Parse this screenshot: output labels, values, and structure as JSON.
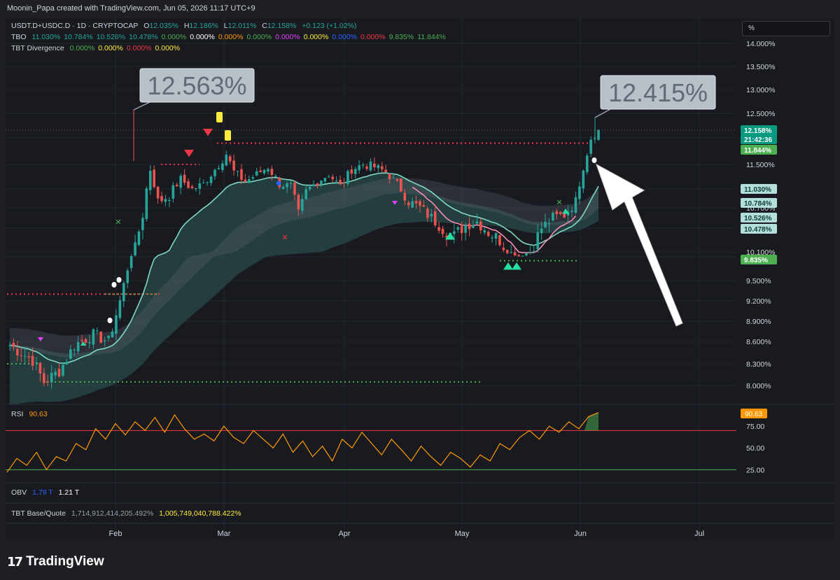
{
  "header": {
    "credit": "Moonin_Papa created with TradingView.com, Jun 05, 2026 11:17 UTC+9"
  },
  "legend": {
    "symbol": "USDT.D+USDC.D · 1D · CRYPTOCAP",
    "ohlc": [
      {
        "label": "O",
        "value": "12.035%"
      },
      {
        "label": "H",
        "value": "12.186%"
      },
      {
        "label": "L",
        "value": "12.011%"
      },
      {
        "label": "C",
        "value": "12.158%"
      }
    ],
    "change": "+0.123 (+1.02%)",
    "tbo_name": "TBO",
    "tbo_values": [
      {
        "v": "11.030%",
        "c": "#26a69a"
      },
      {
        "v": "10.784%",
        "c": "#26a69a"
      },
      {
        "v": "10.526%",
        "c": "#26a69a"
      },
      {
        "v": "10.478%",
        "c": "#26a69a"
      },
      {
        "v": "0.000%",
        "c": "#4caf50"
      },
      {
        "v": "0.000%",
        "c": "#ffffff"
      },
      {
        "v": "0.000%",
        "c": "#ff9800"
      },
      {
        "v": "0.000%",
        "c": "#4caf50"
      },
      {
        "v": "0.000%",
        "c": "#e040fb"
      },
      {
        "v": "0.000%",
        "c": "#ffeb3b"
      },
      {
        "v": "0.000%",
        "c": "#2962ff"
      },
      {
        "v": "0.000%",
        "c": "#f23645"
      },
      {
        "v": "9.835%",
        "c": "#4caf50"
      },
      {
        "v": "11.844%",
        "c": "#4caf50"
      }
    ],
    "tbt_name": "TBT Divergence",
    "tbt_values": [
      {
        "v": "0.000%",
        "c": "#4caf50"
      },
      {
        "v": "0.000%",
        "c": "#ffeb3b"
      },
      {
        "v": "0.000%",
        "c": "#f23645"
      },
      {
        "v": "0.000%",
        "c": "#ffeb3b"
      }
    ],
    "rsi_name": "RSI",
    "rsi_value": "90.63",
    "obv_name": "OBV",
    "obv_v1": "1.79 T",
    "obv_v2": "1.21 T",
    "tbtbq_name": "TBT Base/Quote",
    "tbtbq_v1": "1,714,912,414,205.492%",
    "tbtbq_v2": "1,005,749,040,788.422%"
  },
  "scale_unit": "%",
  "callouts": {
    "high_left": "12.563%",
    "high_right": "12.415%"
  },
  "price_tags": [
    {
      "text": "12.158%",
      "value": 12.158,
      "bg": "#089981",
      "fg": "#ffffff"
    },
    {
      "text": "21:42:36",
      "value": 12.02,
      "bg": "#089981",
      "fg": "#ffffff"
    },
    {
      "text": "11.844%",
      "value": 11.844,
      "bg": "#4caf50",
      "fg": "#ffffff"
    },
    {
      "text": "11.030%",
      "value": 11.03,
      "bg": "#b2dfdb",
      "fg": "#0d3b36"
    },
    {
      "text": "10.784%",
      "value": 10.784,
      "bg": "#b2dfdb",
      "fg": "#0d3b36"
    },
    {
      "text": "10.526%",
      "value": 10.526,
      "bg": "#b2dfdb",
      "fg": "#0d3b36"
    },
    {
      "text": "10.478%",
      "value": 10.478,
      "bg": "#b2dfdb",
      "fg": "#0d3b36"
    },
    {
      "text": "9.835%",
      "value": 9.835,
      "bg": "#4caf50",
      "fg": "#ffffff"
    }
  ],
  "rsi_tag": "90.63",
  "footer": {
    "brand": "TradingView",
    "logo_mark": "17"
  },
  "colors": {
    "up": "#26a69a",
    "down": "#ef5350",
    "rsi": "#ff9800",
    "ema_fast": "#7fd9c4",
    "ema_mid": "#f48fb1",
    "cloud": "#2f5b57",
    "support": "#4caf50",
    "resistance": "#f23645"
  },
  "chart_data": [
    {
      "type": "candlestick",
      "title": "USDT.D+USDC.D · 1D · CRYPTOCAP",
      "x_ticks": [
        "Feb",
        "Mar",
        "Apr",
        "May",
        "Jun",
        "Jul"
      ],
      "y_ticks": [
        "14.000%",
        "13.500%",
        "13.000%",
        "12.500%",
        "12.000%",
        "11.500%",
        "11.000%",
        "10.700%",
        "10.400%",
        "10.100%",
        "9.800%",
        "9.500%",
        "9.200%",
        "8.900%",
        "8.600%",
        "8.300%",
        "8.000%"
      ],
      "ylim": [
        7.8,
        14.2
      ],
      "annotations": [
        "12.563%",
        "12.415%"
      ],
      "levels": [
        {
          "name": "resistance",
          "value": 11.9
        },
        {
          "name": "resistance",
          "value": 11.5
        },
        {
          "name": "resistance",
          "value": 9.3
        },
        {
          "name": "support",
          "value": 9.75
        },
        {
          "name": "support",
          "value": 9.3
        },
        {
          "name": "support",
          "value": 8.3
        },
        {
          "name": "support",
          "value": 8.05
        }
      ],
      "keypoints": [
        {
          "date": "Jan 01",
          "close": 8.55
        },
        {
          "date": "Jan 07",
          "close": 8.35
        },
        {
          "date": "Jan 10",
          "close": 8.05
        },
        {
          "date": "Jan 14",
          "close": 8.2
        },
        {
          "date": "Jan 18",
          "close": 8.55
        },
        {
          "date": "Jan 23",
          "close": 8.7
        },
        {
          "date": "Jan 27",
          "close": 8.6
        },
        {
          "date": "Jan 30",
          "close": 9.2
        },
        {
          "date": "Feb 02",
          "close": 9.9
        },
        {
          "date": "Feb 05",
          "close": 10.6
        },
        {
          "date": "Feb 07",
          "close": 11.4
        },
        {
          "date": "Feb 09",
          "close": 10.8
        },
        {
          "date": "Feb 12",
          "close": 10.9
        },
        {
          "date": "Feb 15",
          "close": 11.2
        },
        {
          "date": "Feb 18",
          "close": 11.0
        },
        {
          "date": "Feb 21",
          "close": 11.1
        },
        {
          "date": "Feb 24",
          "close": 11.4
        },
        {
          "date": "Feb 27",
          "close": 11.7
        },
        {
          "date": "Mar 01",
          "close": 11.35
        },
        {
          "date": "Mar 04",
          "close": 11.15
        },
        {
          "date": "Mar 07",
          "close": 11.3
        },
        {
          "date": "Mar 10",
          "close": 11.45
        },
        {
          "date": "Mar 13",
          "close": 11.1
        },
        {
          "date": "Mar 16",
          "close": 11.05
        },
        {
          "date": "Mar 18",
          "close": 10.6
        },
        {
          "date": "Mar 20",
          "close": 10.95
        },
        {
          "date": "Mar 23",
          "close": 11.15
        },
        {
          "date": "Mar 26",
          "close": 11.3
        },
        {
          "date": "Mar 29",
          "close": 11.05
        },
        {
          "date": "Apr 01",
          "close": 11.4
        },
        {
          "date": "Apr 04",
          "close": 11.5
        },
        {
          "date": "Apr 07",
          "close": 11.45
        },
        {
          "date": "Apr 10",
          "close": 11.35
        },
        {
          "date": "Apr 13",
          "close": 11.1
        },
        {
          "date": "Apr 16",
          "close": 10.8
        },
        {
          "date": "Apr 19",
          "close": 10.7
        },
        {
          "date": "Apr 22",
          "close": 10.55
        },
        {
          "date": "Apr 25",
          "close": 10.4
        },
        {
          "date": "Apr 28",
          "close": 10.3
        },
        {
          "date": "May 01",
          "close": 10.45
        },
        {
          "date": "May 04",
          "close": 10.5
        },
        {
          "date": "May 07",
          "close": 10.35
        },
        {
          "date": "May 10",
          "close": 10.25
        },
        {
          "date": "May 13",
          "close": 10.05
        },
        {
          "date": "May 15",
          "close": 9.85
        },
        {
          "date": "May 18",
          "close": 10.1
        },
        {
          "date": "May 21",
          "close": 10.4
        },
        {
          "date": "May 24",
          "close": 10.55
        },
        {
          "date": "May 27",
          "close": 10.6
        },
        {
          "date": "May 30",
          "close": 10.8
        },
        {
          "date": "Jun 01",
          "close": 11.45
        },
        {
          "date": "Jun 03",
          "close": 12.0
        },
        {
          "date": "Jun 05",
          "close": 12.158
        }
      ]
    },
    {
      "type": "line",
      "title": "RSI",
      "y_ticks": [
        "75.00",
        "50.00",
        "25.00"
      ],
      "ylim": [
        10,
        100
      ],
      "levels": [
        {
          "name": "overbought",
          "value": 70
        },
        {
          "name": "oversold",
          "value": 25
        }
      ],
      "values": [
        22,
        38,
        30,
        45,
        25,
        40,
        35,
        55,
        48,
        72,
        60,
        78,
        65,
        80,
        70,
        85,
        68,
        88,
        72,
        60,
        66,
        58,
        75,
        62,
        55,
        70,
        60,
        50,
        66,
        45,
        58,
        40,
        52,
        35,
        60,
        50,
        68,
        55,
        42,
        60,
        48,
        35,
        52,
        40,
        30,
        45,
        38,
        28,
        42,
        35,
        55,
        48,
        62,
        70,
        60,
        75,
        68,
        80,
        72,
        86,
        90.63
      ]
    }
  ]
}
